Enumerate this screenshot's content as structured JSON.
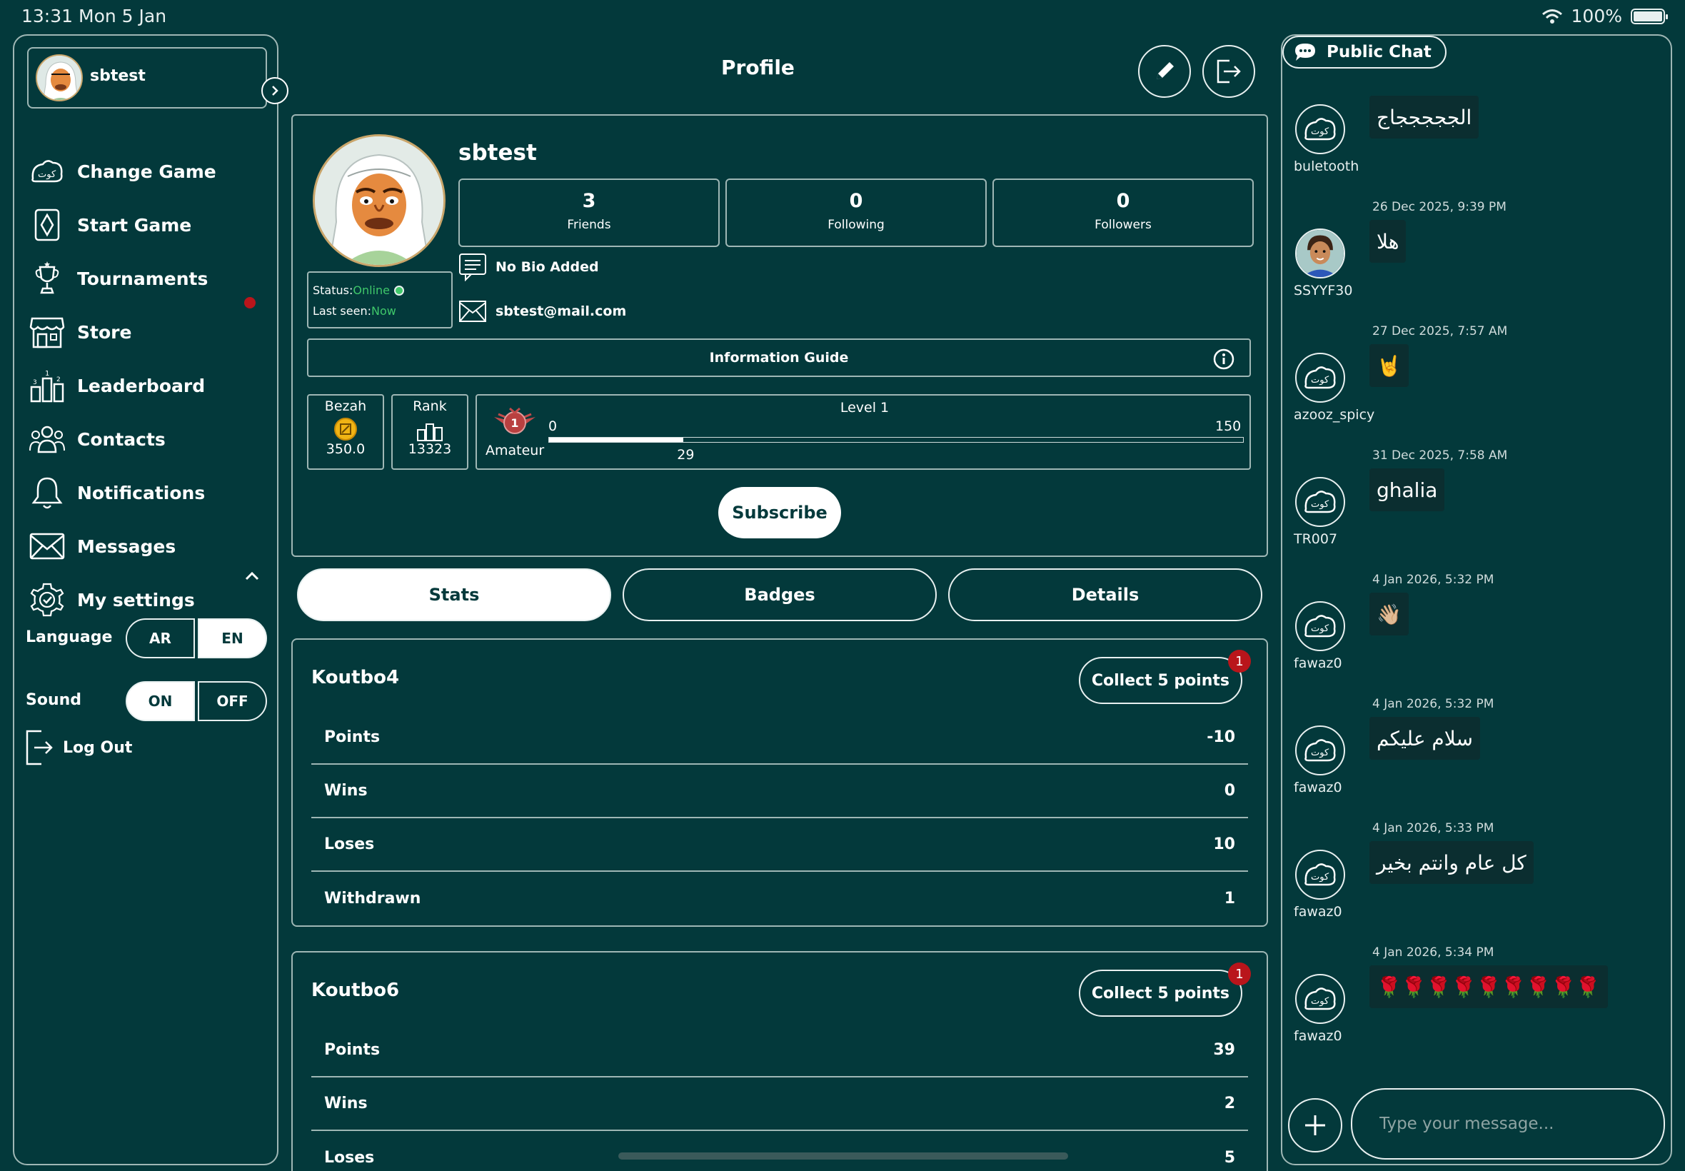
{
  "status_bar": {
    "time": "13:31  Mon 5 Jan",
    "battery": "100%",
    "battery_level": 1.0
  },
  "sidebar": {
    "username": "sbtest",
    "nav": [
      {
        "label": "Change Game",
        "icon": "koutbo-logo-icon"
      },
      {
        "label": "Start Game",
        "icon": "cards-icon"
      },
      {
        "label": "Tournaments",
        "icon": "trophy-icon"
      },
      {
        "label": "Store",
        "icon": "store-icon"
      },
      {
        "label": "Leaderboard",
        "icon": "leaderboard-icon"
      },
      {
        "label": "Contacts",
        "icon": "contacts-icon"
      },
      {
        "label": "Notifications",
        "icon": "bell-icon"
      },
      {
        "label": "Messages",
        "icon": "envelope-icon"
      },
      {
        "label": "My settings",
        "icon": "gear-icon"
      }
    ],
    "settings": {
      "language_label": "Language",
      "language_options": [
        "AR",
        "EN"
      ],
      "language_selected": "EN",
      "sound_label": "Sound",
      "sound_options": [
        "ON",
        "OFF"
      ],
      "sound_selected": "ON"
    },
    "logout_label": "Log Out"
  },
  "header": {
    "title": "Profile"
  },
  "profile": {
    "name": "sbtest",
    "stats": [
      {
        "value": "3",
        "label": "Friends"
      },
      {
        "value": "0",
        "label": "Following"
      },
      {
        "value": "0",
        "label": "Followers"
      }
    ],
    "status_label": "Status:",
    "status_value": "Online",
    "last_seen_label": "Last seen:",
    "last_seen_value": "Now",
    "bio": "No Bio Added",
    "email": "sbtest@mail.com",
    "info_guide": "Information Guide",
    "bezah_label": "Bezah",
    "bezah_value": "350.0",
    "rank_label": "Rank",
    "rank_value": "13323",
    "level_title": "Level 1",
    "level_tier": "Amateur",
    "level_badge_number": "1",
    "level_min": "0",
    "level_max": "150",
    "level_current": "29",
    "level_progress_value": 29,
    "level_progress_max": 150,
    "subscribe_label": "Subscribe"
  },
  "tabs": [
    {
      "label": "Stats",
      "active": true
    },
    {
      "label": "Badges",
      "active": false
    },
    {
      "label": "Details",
      "active": false
    }
  ],
  "games": [
    {
      "name": "Koutbo4",
      "collect_label": "Collect 5 points",
      "badge": "1",
      "rows": [
        {
          "label": "Points",
          "value": "-10"
        },
        {
          "label": "Wins",
          "value": "0"
        },
        {
          "label": "Loses",
          "value": "10"
        },
        {
          "label": "Withdrawn",
          "value": "1"
        }
      ]
    },
    {
      "name": "Koutbo6",
      "collect_label": "Collect 5 points",
      "badge": "1",
      "rows": [
        {
          "label": "Points",
          "value": "39"
        },
        {
          "label": "Wins",
          "value": "2"
        },
        {
          "label": "Loses",
          "value": "5"
        }
      ]
    }
  ],
  "chat": {
    "title": "Public Chat",
    "placeholder": "Type your message...",
    "messages": [
      {
        "time": "",
        "user": "buletooth",
        "text": "الجججججاج"
      },
      {
        "time": "26 Dec 2025, 9:39 PM",
        "user": "SSYYF30",
        "text": "هلا"
      },
      {
        "time": "27 Dec 2025, 7:57 AM",
        "user": "azooz_spicy",
        "text": "🤘"
      },
      {
        "time": "31 Dec 2025, 7:58 AM",
        "user": "TR007",
        "text": "ghalia"
      },
      {
        "time": "4 Jan 2026, 5:32 PM",
        "user": "fawaz0",
        "text": "👋🏼"
      },
      {
        "time": "4 Jan 2026, 5:32 PM",
        "user": "fawaz0",
        "text": "سلام عليكم"
      },
      {
        "time": "4 Jan 2026, 5:33 PM",
        "user": "fawaz0",
        "text": "كل عام وانتم بخير"
      },
      {
        "time": "4 Jan 2026, 5:34 PM",
        "user": "fawaz0",
        "text": "🌹🌹🌹🌹🌹🌹🌹🌹🌹"
      }
    ]
  },
  "colors": {
    "background": "#03393b",
    "border": "#9fb7b5",
    "online": "#3fc76a",
    "badge_red": "#b9151b"
  }
}
